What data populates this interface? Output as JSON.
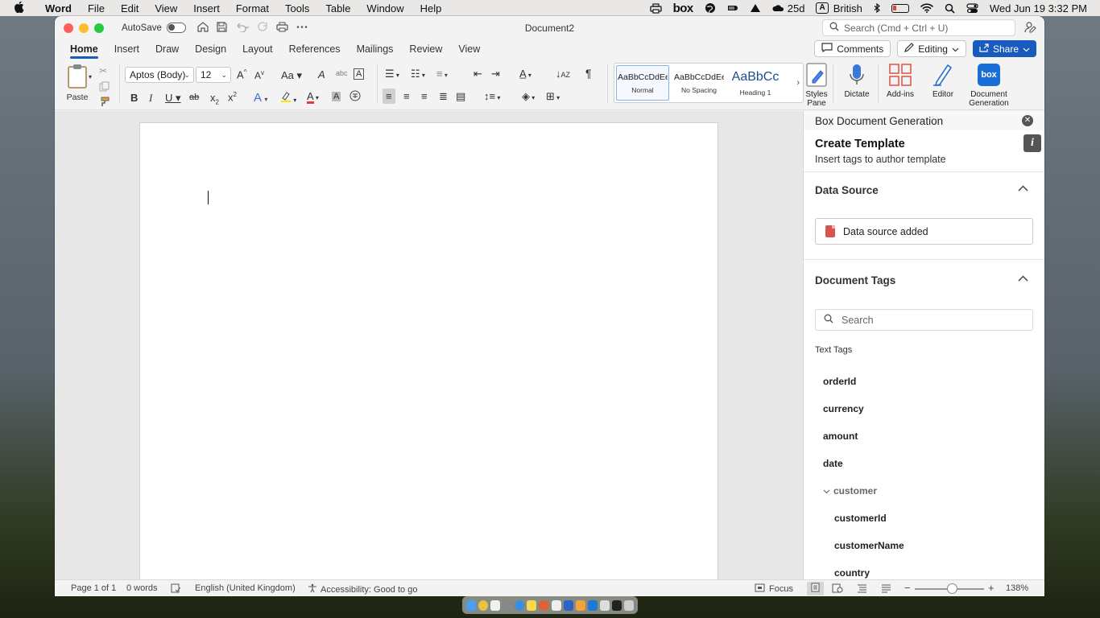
{
  "menubar": {
    "app_name": "Word",
    "menus": [
      "File",
      "Edit",
      "View",
      "Insert",
      "Format",
      "Tools",
      "Table",
      "Window",
      "Help"
    ],
    "status": {
      "box_logo": "box",
      "weather": "25d",
      "input_badge": "A",
      "input_source": "British",
      "datetime": "Wed Jun 19  3:32 PM"
    }
  },
  "titlebar": {
    "autosave_label": "AutoSave",
    "document_title": "Document2",
    "search_placeholder": "Search (Cmd + Ctrl + U)"
  },
  "tabs": [
    "Home",
    "Insert",
    "Draw",
    "Design",
    "Layout",
    "References",
    "Mailings",
    "Review",
    "View"
  ],
  "tab_actions": {
    "comments": "Comments",
    "editing": "Editing",
    "share": "Share"
  },
  "ribbon": {
    "paste_label": "Paste",
    "font_name": "Aptos (Body)",
    "font_size": "12",
    "styles": [
      {
        "preview": "AaBbCcDdEe",
        "label": "Normal"
      },
      {
        "preview": "AaBbCcDdEe",
        "label": "No Spacing"
      },
      {
        "preview": "AaBbCc",
        "label": "Heading 1"
      }
    ],
    "styles_pane": "Styles Pane",
    "dictate": "Dictate",
    "addins": "Add-ins",
    "editor": "Editor",
    "docgen": "Document Generation",
    "docgen_logo": "box"
  },
  "panel": {
    "header": "Box Document Generation",
    "create_title": "Create Template",
    "create_subtitle": "Insert tags to author template",
    "data_source_title": "Data Source",
    "data_source_status": "Data source added",
    "document_tags_title": "Document Tags",
    "tag_search_placeholder": "Search",
    "text_tags_label": "Text Tags",
    "tags": [
      "orderId",
      "currency",
      "amount",
      "date"
    ],
    "group_name": "customer",
    "group_tags": [
      "customerId",
      "customerName",
      "country"
    ]
  },
  "statusbar": {
    "page": "Page 1 of 1",
    "words": "0 words",
    "language": "English (United Kingdom)",
    "accessibility": "Accessibility: Good to go",
    "focus": "Focus",
    "zoom": "138%"
  },
  "colors": {
    "accent_blue": "#185abd",
    "box_blue": "#1a6fd6",
    "pdf_red": "#d9534f"
  }
}
